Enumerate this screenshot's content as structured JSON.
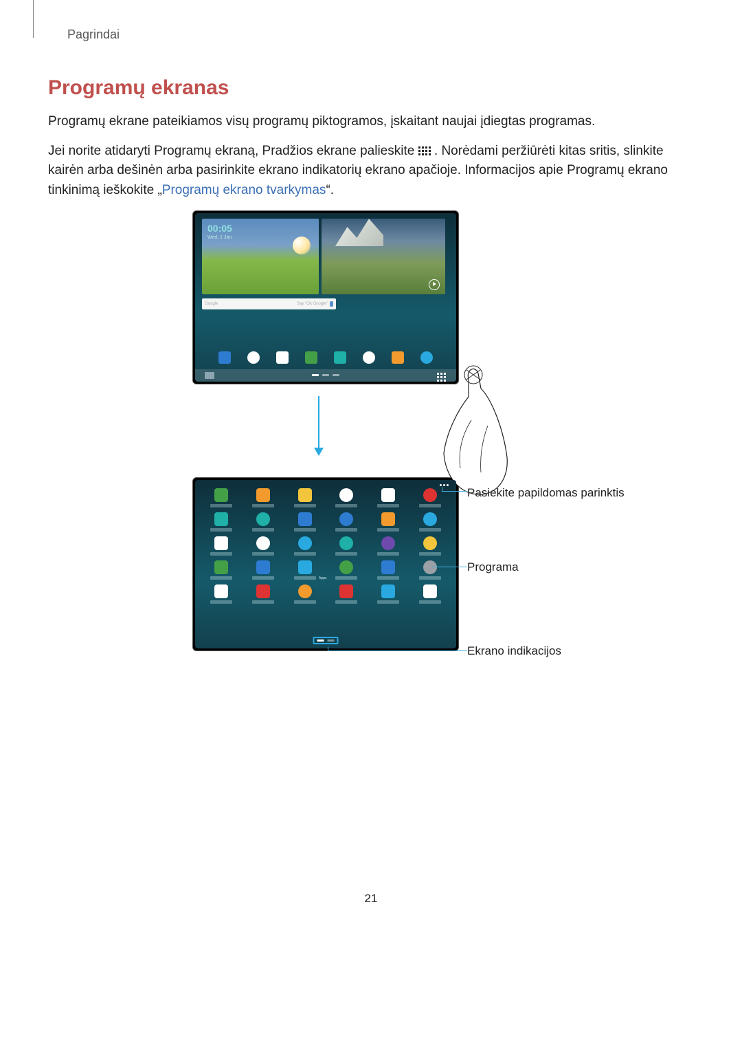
{
  "breadcrumb": "Pagrindai",
  "title": "Programų ekranas",
  "p1": "Programų ekrane pateikiamos visų programų piktogramos, įskaitant naujai įdiegtas programas.",
  "p2a": "Jei norite atidaryti Programų ekraną, Pradžios ekrane palieskite ",
  "p2b": ". Norėdami peržiūrėti kitas sritis, slinkite kairėn arba dešinėn arba pasirinkite ekrano indikatorių ekrano apačioje. Informacijos apie Programų ekrano tinkinimą ieškokite „",
  "link": "Programų ekrano tvarkymas",
  "p2c": "“.",
  "home": {
    "clock": "00:05",
    "date": "Wed, 1 Jan",
    "search_label": "Google",
    "search_hint": "Say \"Ok Google\"",
    "dock": [
      {
        "name": "apps-collection",
        "bg": "bg-blue"
      },
      {
        "name": "chrome",
        "bg": "bg-white rnd"
      },
      {
        "name": "play-store",
        "bg": "bg-white"
      },
      {
        "name": "phone",
        "bg": "bg-green"
      },
      {
        "name": "email",
        "bg": "bg-teal"
      },
      {
        "name": "internet",
        "bg": "bg-white rnd"
      },
      {
        "name": "gallery",
        "bg": "bg-orange"
      },
      {
        "name": "settings",
        "bg": "bg-cyan rnd"
      }
    ]
  },
  "apps": {
    "rows": [
      [
        {
          "n": "phone",
          "c": "bg-green"
        },
        {
          "n": "contacts",
          "c": "bg-orange"
        },
        {
          "n": "my-files",
          "c": "bg-yellow"
        },
        {
          "n": "internet",
          "c": "bg-white rnd"
        },
        {
          "n": "calendar",
          "c": "bg-white"
        },
        {
          "n": "youtube",
          "c": "bg-red rnd"
        }
      ],
      [
        {
          "n": "email",
          "c": "bg-teal"
        },
        {
          "n": "music",
          "c": "bg-teal rnd"
        },
        {
          "n": "video",
          "c": "bg-blue"
        },
        {
          "n": "camera",
          "c": "bg-blue rnd"
        },
        {
          "n": "gallery",
          "c": "bg-orange"
        },
        {
          "n": "settings",
          "c": "bg-cyan rnd"
        }
      ],
      [
        {
          "n": "calculator",
          "c": "bg-white"
        },
        {
          "n": "clock",
          "c": "bg-white rnd"
        },
        {
          "n": "help",
          "c": "bg-cyan rnd"
        },
        {
          "n": "downloads",
          "c": "bg-teal rnd"
        },
        {
          "n": "assistant",
          "c": "bg-purple rnd"
        },
        {
          "n": "docs",
          "c": "bg-yellow rnd"
        }
      ],
      [
        {
          "n": "planner",
          "c": "bg-green"
        },
        {
          "n": "smart-remote",
          "c": "bg-blue"
        },
        {
          "n": "browser",
          "c": "bg-cyan"
        },
        {
          "n": "hangouts",
          "c": "bg-green rnd"
        },
        {
          "n": "google",
          "c": "bg-blue"
        },
        {
          "n": "voice",
          "c": "bg-grey rnd"
        }
      ],
      [
        {
          "n": "gmail",
          "c": "bg-white"
        },
        {
          "n": "google-plus",
          "c": "bg-red"
        },
        {
          "n": "play-music",
          "c": "bg-orange rnd"
        },
        {
          "n": "play-movies",
          "c": "bg-red"
        },
        {
          "n": "play-books",
          "c": "bg-cyan"
        },
        {
          "n": "drive",
          "c": "bg-white"
        }
      ]
    ],
    "group_label": "Apps"
  },
  "callouts": {
    "more": "Pasiekite papildomas parinktis",
    "app": "Programa",
    "indicators": "Ekrano indikacijos"
  },
  "page_number": "21"
}
